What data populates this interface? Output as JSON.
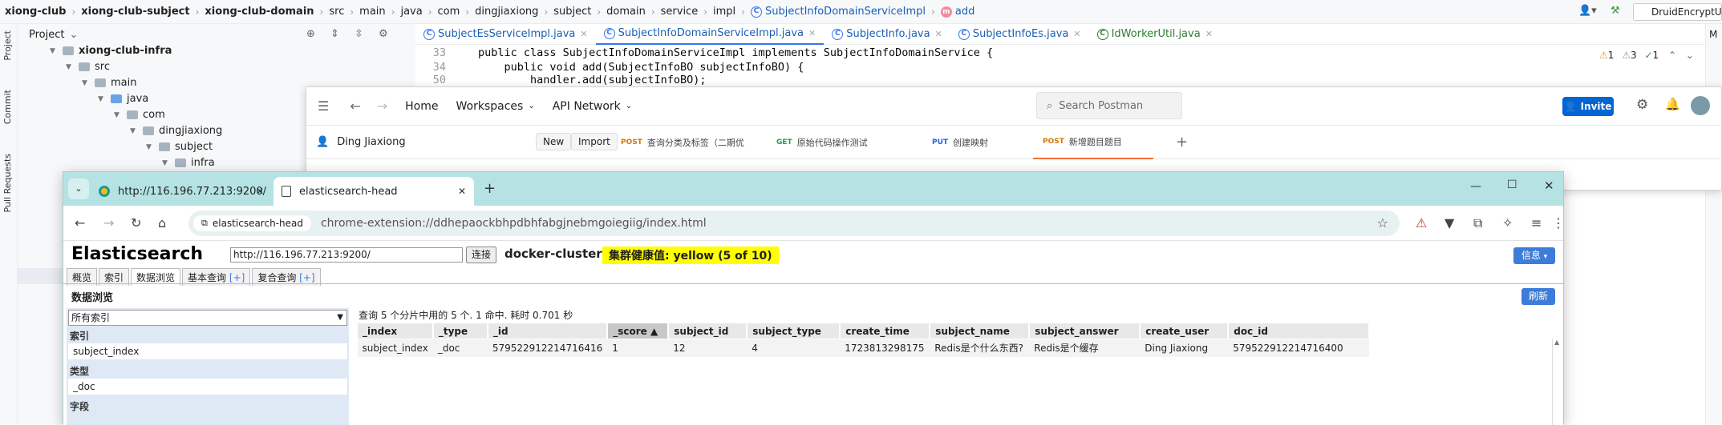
{
  "ide": {
    "breadcrumbs": [
      "xiong-club",
      "xiong-club-subject",
      "xiong-club-domain",
      "src",
      "main",
      "java",
      "com",
      "dingjiaxiong",
      "subject",
      "domain",
      "service",
      "impl",
      "SubjectInfoDomainServiceImpl",
      "add"
    ],
    "right_label": "DruidEncryptU",
    "right_edge_label": "M",
    "side_tabs": [
      "Project",
      "Commit",
      "Pull Requests"
    ],
    "project_title": "Project",
    "tree": [
      "xiong-club-infra",
      "src",
      "main",
      "java",
      "com",
      "dingjiaxiong",
      "subject",
      "infra"
    ],
    "editor_tabs": [
      "SubjectEsServiceImpl.java",
      "SubjectInfoDomainServiceImpl.java",
      "SubjectInfo.java",
      "SubjectInfoEs.java",
      "IdWorkerUtil.java"
    ],
    "line_numbers": [
      "33",
      "34",
      "50"
    ],
    "code": [
      "public class SubjectInfoDomainServiceImpl implements SubjectInfoDomainService {",
      "    public void add(SubjectInfoBO subjectInfoBO) {",
      "        handler.add(subjectInfoBO);"
    ],
    "inspections": {
      "warnings": "1",
      "weak": "3",
      "ok": "1"
    }
  },
  "postman": {
    "nav": [
      "Home",
      "Workspaces",
      "API Network"
    ],
    "search_placeholder": "Search Postman",
    "invite": "Invite",
    "workspace_user": "Ding Jiaxiong",
    "new_btn": "New",
    "import_btn": "Import",
    "requests": [
      {
        "method": "POST",
        "name": "查询分类及标签（二期优",
        "color": "#d97706"
      },
      {
        "method": "GET",
        "name": "原始代码操作测试",
        "color": "#16a34a"
      },
      {
        "method": "PUT",
        "name": "创建映射",
        "color": "#2563eb"
      },
      {
        "method": "POST",
        "name": "新增题目题目",
        "color": "#d97706"
      }
    ]
  },
  "browser": {
    "tabs": [
      "http://116.196.77.213:9200/",
      "elasticsearch-head"
    ],
    "ext_chip": "elasticsearch-head",
    "url": "chrome-extension://ddhepaockbhpdbhfabgjnebmgoiegiig/index.html",
    "accent": "#b5e3e3"
  },
  "eshead": {
    "title": "Elasticsearch",
    "url_value": "http://116.196.77.213:9200/",
    "connect": "连接",
    "cluster": "docker-cluster",
    "health": "集群健康值: yellow (5 of 10)",
    "info": "信息",
    "tabs": [
      "概览",
      "索引",
      "数据浏览",
      "基本查询",
      "复合查询"
    ],
    "plus": "[+]",
    "section": "数据浏览",
    "refresh": "刷新",
    "select": "所有索引",
    "side": {
      "h_index": "索引",
      "index": "subject_index",
      "h_type": "类型",
      "type": "_doc",
      "h_field": "字段"
    },
    "status": "查询 5 个分片中用的 5 个. 1 命中. 耗时 0.701 秒",
    "columns": [
      "_index",
      "_type",
      "_id",
      "_score ▲",
      "subject_id",
      "subject_type",
      "create_time",
      "subject_name",
      "subject_answer",
      "create_user",
      "doc_id"
    ],
    "row": [
      "subject_index",
      "_doc",
      "579522912214716416",
      "1",
      "12",
      "4",
      "1723813298175",
      "Redis是个什么东西?",
      "Redis是个缓存",
      "Ding Jiaxiong",
      "579522912214716400"
    ],
    "health_color": "#ffff00",
    "button_color": "#3d7cd9"
  }
}
